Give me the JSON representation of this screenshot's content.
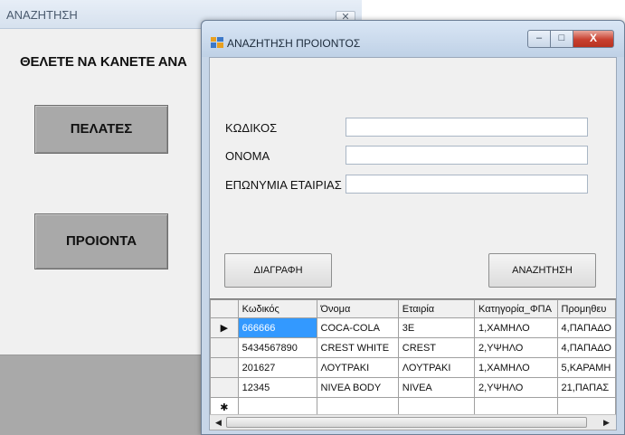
{
  "background_window": {
    "title": "ΑΝΑΖΗΤΗΣΗ",
    "close_glyph": "✕",
    "heading": "ΘΕΛΕΤΕ ΝΑ ΚΑΝΕΤΕ ΑΝΑ",
    "customers_button": "ΠΕΛΑΤΕΣ",
    "products_button": "ΠΡΟΙΟΝΤΑ"
  },
  "dialog": {
    "title": "ΑΝΑΖΗΤΗΣΗ ΠΡΟΙΟΝΤΟΣ",
    "minimize_glyph": "–",
    "maximize_glyph": "□",
    "close_glyph": "X",
    "fields": {
      "code_label": "ΚΩΔΙΚΟΣ",
      "code_value": "",
      "name_label": "ΟΝΟΜΑ",
      "name_value": "",
      "company_label": "ΕΠΩΝΥΜΙΑ ΕΤΑΙΡΙΑΣ",
      "company_value": ""
    },
    "delete_button": "ΔΙΑΓΡΑΦΗ",
    "search_button": "ΑΝΑΖΗΤΗΣΗ"
  },
  "grid": {
    "current_row_marker": "▶",
    "new_row_marker": "✱",
    "columns": [
      "Κωδικός",
      "Όνομα",
      "Εταιρία",
      "Κατηγορία_ΦΠΑ",
      "Προμηθευ"
    ],
    "rows": [
      [
        "666666",
        "COCA-COLA",
        "3E",
        "1,ΧΑΜΗΛΟ",
        "4,ΠΑΠΑΔΟ"
      ],
      [
        "5434567890",
        "CREST WHITE",
        "CREST",
        "2,ΥΨΗΛΟ",
        "4,ΠΑΠΑΔΟ"
      ],
      [
        "201627",
        "ΛΟΥΤΡΑΚΙ",
        "ΛΟΥΤΡΑΚΙ",
        "1,ΧΑΜΗΛΟ",
        "5,ΚΑΡΑΜΗ"
      ],
      [
        "12345",
        "NIVEA BODY",
        "NIVEA",
        "2,ΥΨΗΛΟ",
        "21,ΠΑΠΑΣ"
      ]
    ],
    "scroll_left_glyph": "◀",
    "scroll_right_glyph": "▶"
  },
  "colors": {
    "selection": "#3399ff",
    "dialog_frame": "#c7d6e8",
    "close_red": "#c8402f"
  }
}
